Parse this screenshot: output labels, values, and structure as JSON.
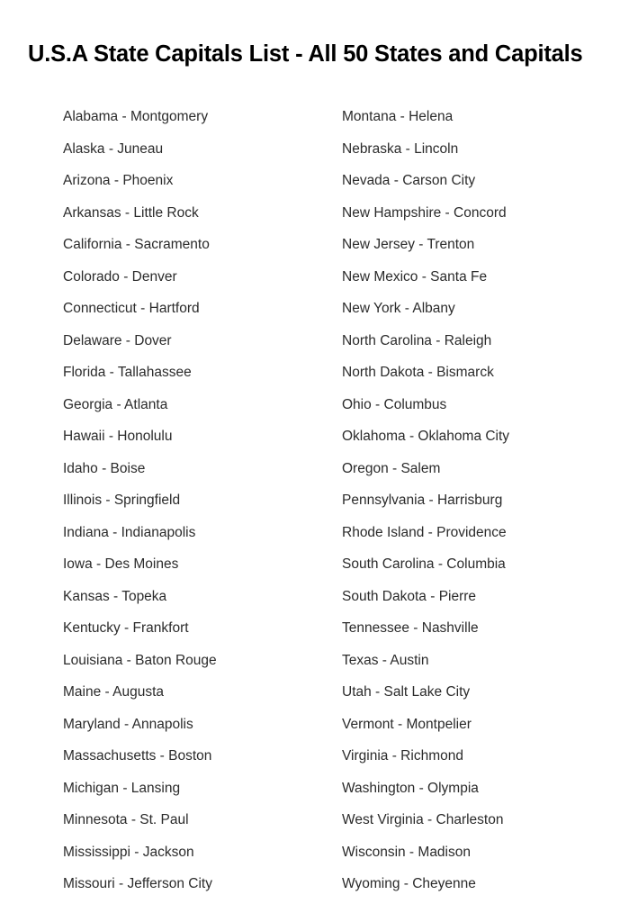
{
  "document": {
    "title": "U.S.A State Capitals List - All 50 States and Capitals",
    "columns": {
      "left": [
        "Alabama - Montgomery",
        "Alaska - Juneau",
        "Arizona - Phoenix",
        "Arkansas - Little Rock",
        "California - Sacramento",
        "Colorado - Denver",
        "Connecticut - Hartford",
        "Delaware - Dover",
        "Florida - Tallahassee",
        "Georgia - Atlanta",
        "Hawaii - Honolulu",
        "Idaho - Boise",
        "Illinois - Springfield",
        "Indiana - Indianapolis",
        "Iowa - Des Moines",
        "Kansas - Topeka",
        "Kentucky - Frankfort",
        "Louisiana - Baton Rouge",
        "Maine - Augusta",
        "Maryland - Annapolis",
        "Massachusetts - Boston",
        "Michigan - Lansing",
        "Minnesota - St. Paul",
        "Mississippi - Jackson",
        "Missouri - Jefferson City"
      ],
      "right": [
        "Montana - Helena",
        "Nebraska - Lincoln",
        "Nevada - Carson City",
        "New Hampshire - Concord",
        "New Jersey - Trenton",
        "New Mexico - Santa Fe",
        "New York - Albany",
        "North Carolina - Raleigh",
        "North Dakota - Bismarck",
        "Ohio - Columbus",
        "Oklahoma - Oklahoma City",
        "Oregon - Salem",
        "Pennsylvania - Harrisburg",
        "Rhode Island - Providence",
        "South Carolina - Columbia",
        "South Dakota - Pierre",
        "Tennessee - Nashville",
        "Texas - Austin",
        "Utah - Salt Lake City",
        "Vermont - Montpelier",
        "Virginia - Richmond",
        "Washington - Olympia",
        "West Virginia - Charleston",
        "Wisconsin - Madison",
        "Wyoming - Cheyenne"
      ]
    }
  },
  "colors": {
    "background": "#ffffff",
    "title_text": "#000000",
    "body_text": "#2b2b2b"
  }
}
